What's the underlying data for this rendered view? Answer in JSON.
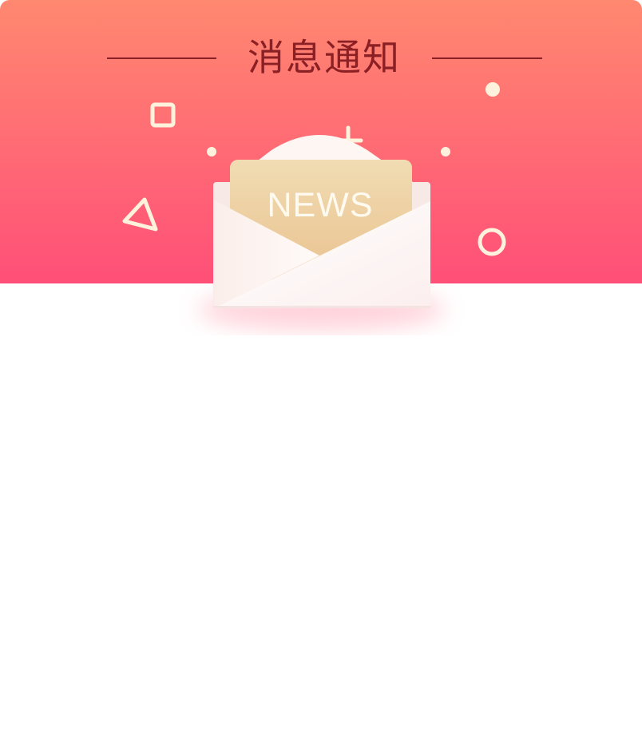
{
  "header": {
    "title": "消息通知"
  },
  "illustration": {
    "label": "NEWS",
    "icon": "news-envelope-icon"
  },
  "colors": {
    "banner_top": "#ff8870",
    "banner_bottom": "#ff4f78",
    "title_text": "#8a1f24",
    "decoration": "#fff2dc",
    "news_card": "#f0d8ac",
    "envelope": "#fdf7f5"
  }
}
